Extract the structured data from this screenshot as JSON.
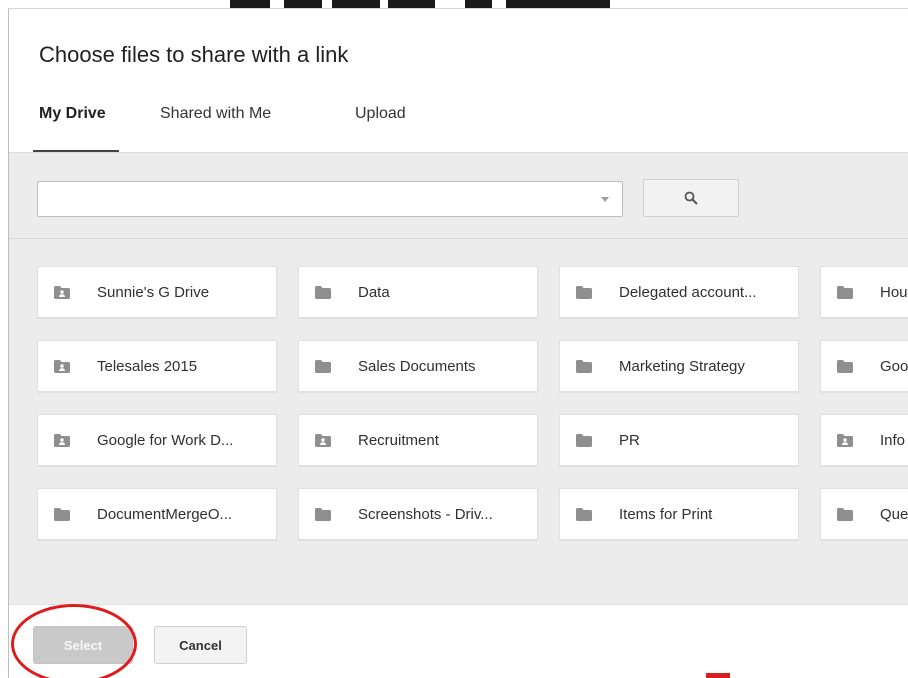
{
  "dialog": {
    "title": "Choose files to share with a link"
  },
  "tabs": [
    {
      "label": "My Drive",
      "active": true
    },
    {
      "label": "Shared with Me",
      "active": false
    },
    {
      "label": "Upload",
      "active": false
    }
  ],
  "search": {
    "value": "",
    "placeholder": "",
    "button_icon": "search-icon"
  },
  "folders": [
    {
      "label": "Sunnie's G Drive",
      "icon": "shared-folder-icon"
    },
    {
      "label": "Data",
      "icon": "folder-icon"
    },
    {
      "label": "Delegated account...",
      "icon": "folder-icon"
    },
    {
      "label": "Hou",
      "icon": "folder-icon"
    },
    {
      "label": "Telesales 2015",
      "icon": "shared-folder-icon"
    },
    {
      "label": "Sales Documents",
      "icon": "folder-icon"
    },
    {
      "label": "Marketing Strategy",
      "icon": "folder-icon"
    },
    {
      "label": "Goo",
      "icon": "folder-icon"
    },
    {
      "label": "Google for Work D...",
      "icon": "shared-folder-icon"
    },
    {
      "label": "Recruitment",
      "icon": "shared-folder-icon"
    },
    {
      "label": "PR",
      "icon": "folder-icon"
    },
    {
      "label": "Info",
      "icon": "shared-folder-icon"
    },
    {
      "label": "DocumentMergeO...",
      "icon": "folder-icon"
    },
    {
      "label": "Screenshots - Driv...",
      "icon": "folder-icon"
    },
    {
      "label": "Items for Print",
      "icon": "folder-icon"
    },
    {
      "label": "Que",
      "icon": "folder-icon"
    }
  ],
  "footer": {
    "select_label": "Select",
    "cancel_label": "Cancel"
  },
  "colors": {
    "folder_icon": "#8f8f8f",
    "content_bg": "#ececec",
    "highlight": "#e01b1b"
  }
}
